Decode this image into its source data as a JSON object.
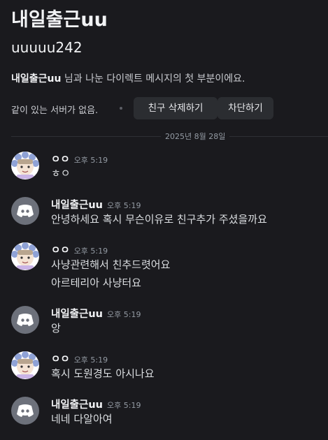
{
  "header": {
    "title": "내일출근uu",
    "username": "uuuuu242",
    "intro_name": "내일출근uu",
    "intro_rest": " 님과 나눈 다이렉트 메시지의 첫 부분이에요.",
    "no_server": "같이 있는 서버가 없음.",
    "unfriend_label": "친구 삭제하기",
    "block_label": "차단하기"
  },
  "date_divider": "2025년 8월 28일",
  "messages": [
    {
      "author": "ㅇㅇ",
      "time": "오후 5:19",
      "avatar": "anime-avatar",
      "lines": [
        "ㅎㅇ"
      ]
    },
    {
      "author": "내일출근uu",
      "time": "오후 5:19",
      "avatar": "discord-avatar",
      "lines": [
        "안녕하세요 혹시 무슨이유로 친구추가 주셨을까요"
      ]
    },
    {
      "author": "ㅇㅇ",
      "time": "오후 5:19",
      "avatar": "anime-avatar",
      "lines": [
        "사냥관련해서 친추드렷어요",
        "아르테리아 사냥터요"
      ]
    },
    {
      "author": "내일출근uu",
      "time": "오후 5:19",
      "avatar": "discord-avatar",
      "lines": [
        "앙"
      ]
    },
    {
      "author": "ㅇㅇ",
      "time": "오후 5:19",
      "avatar": "anime-avatar",
      "lines": [
        "혹시 도원경도 아시나요"
      ]
    },
    {
      "author": "내일출근uu",
      "time": "오후 5:19",
      "avatar": "discord-avatar",
      "lines": [
        "네네 다알아여"
      ]
    }
  ],
  "colors": {
    "background": "#1a1a1e",
    "button_bg": "#2b2d31",
    "discord_avatar_bg": "#6d717b",
    "timestamp": "#949ba4"
  }
}
